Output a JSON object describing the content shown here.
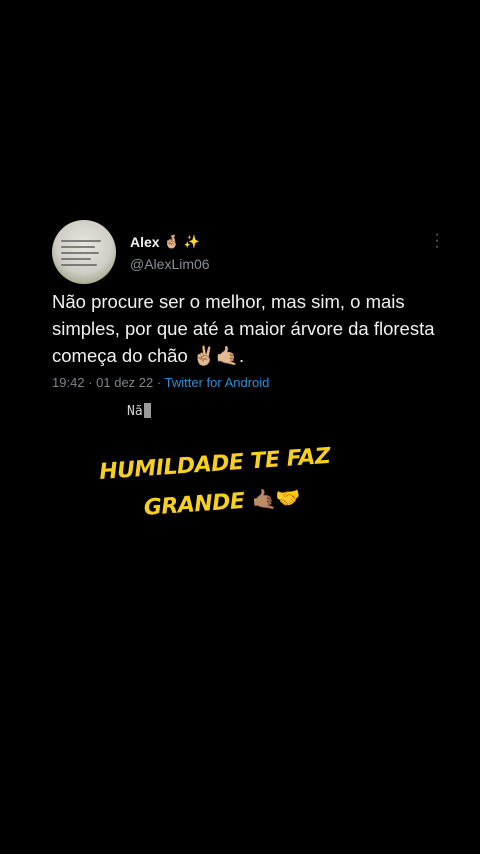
{
  "tweet": {
    "display_name": "Alex",
    "name_emoji": "🤞🏼",
    "name_sparkle": "✨",
    "handle": "@AlexLim06",
    "text": "Não procure ser o melhor, mas sim, o mais simples, por que até a maior árvore da floresta começa do chão ✌🏼🤙🏼.",
    "time": "19:42",
    "separator": "·",
    "date": "01 dez 22",
    "client": "Twitter for Android",
    "more_icon": "more-vertical-icon"
  },
  "typing": {
    "text": "Nã"
  },
  "caption": {
    "line1": "HUMILDADE TE FAZ",
    "line2": "GRANDE",
    "emoji": "🤙🏽🤝",
    "color": "#f7cf1e"
  }
}
